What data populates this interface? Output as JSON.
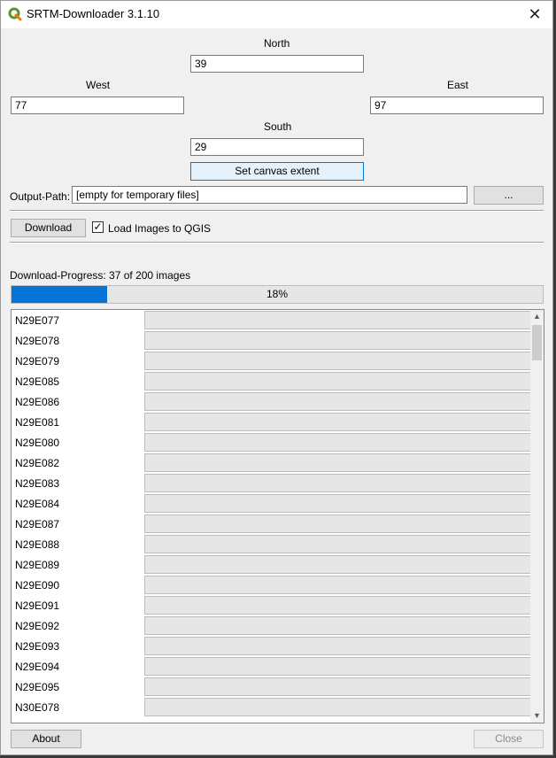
{
  "window": {
    "title": "SRTM-Downloader 3.1.10",
    "app_icon": "qgis-icon",
    "close_glyph": "✕"
  },
  "extent": {
    "north_label": "North",
    "north_value": "39",
    "west_label": "West",
    "west_value": "77",
    "east_label": "East",
    "east_value": "97",
    "south_label": "South",
    "south_value": "29",
    "set_canvas_label": "Set canvas extent"
  },
  "output": {
    "label": "Output-Path:",
    "value": "[empty for temporary files]",
    "browse_label": "..."
  },
  "actions": {
    "download_label": "Download",
    "load_checkbox_checked": true,
    "load_checkbox_mark": "✓",
    "load_checkbox_label": "Load Images to QGIS"
  },
  "progress": {
    "label": "Download-Progress: 37 of 200 images",
    "percent": 18,
    "percent_text": "18%",
    "color": "#0673d6"
  },
  "tiles": [
    {
      "name": "N29E077",
      "progress": 0
    },
    {
      "name": "N29E078",
      "progress": 0
    },
    {
      "name": "N29E079",
      "progress": 0
    },
    {
      "name": "N29E085",
      "progress": 0
    },
    {
      "name": "N29E086",
      "progress": 0
    },
    {
      "name": "N29E081",
      "progress": 0
    },
    {
      "name": "N29E080",
      "progress": 0
    },
    {
      "name": "N29E082",
      "progress": 0
    },
    {
      "name": "N29E083",
      "progress": 0
    },
    {
      "name": "N29E084",
      "progress": 0
    },
    {
      "name": "N29E087",
      "progress": 0
    },
    {
      "name": "N29E088",
      "progress": 0
    },
    {
      "name": "N29E089",
      "progress": 0
    },
    {
      "name": "N29E090",
      "progress": 0
    },
    {
      "name": "N29E091",
      "progress": 0
    },
    {
      "name": "N29E092",
      "progress": 0
    },
    {
      "name": "N29E093",
      "progress": 0
    },
    {
      "name": "N29E094",
      "progress": 0
    },
    {
      "name": "N29E095",
      "progress": 0
    },
    {
      "name": "N30E078",
      "progress": 0
    }
  ],
  "footer": {
    "about_label": "About",
    "close_label": "Close"
  }
}
